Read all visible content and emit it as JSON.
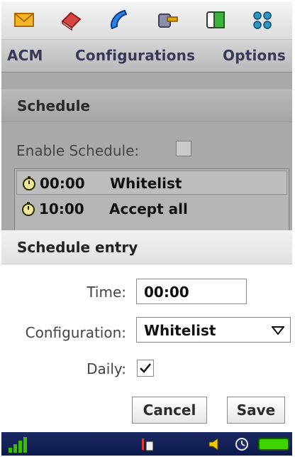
{
  "toolbar_icons": [
    {
      "name": "envelope-icon",
      "color": "#d28a00"
    },
    {
      "name": "book-icon",
      "color": "#c43a3a"
    },
    {
      "name": "phone-icon",
      "color": "#1d6fd1"
    },
    {
      "name": "camera-icon",
      "color": "#6d6f8a"
    },
    {
      "name": "contacts-icon",
      "color": "#2c9c2c"
    },
    {
      "name": "apps-grid-icon",
      "color": "#1e7fa8"
    }
  ],
  "menu": {
    "acm": "ACM",
    "configurations": "Configurations",
    "options": "Options"
  },
  "schedule": {
    "title": "Schedule",
    "enable_label": "Enable Schedule:",
    "enable_checked": false,
    "entries": [
      {
        "time": "00:00",
        "config": "Whitelist",
        "selected": true
      },
      {
        "time": "10:00",
        "config": "Accept all",
        "selected": false
      }
    ]
  },
  "entry": {
    "title": "Schedule entry",
    "time_label": "Time:",
    "time_value": "00:00",
    "config_label": "Configuration:",
    "config_value": "Whitelist",
    "daily_label": "Daily:",
    "daily_checked": true,
    "cancel_label": "Cancel",
    "save_label": "Save"
  },
  "status_icons": [
    "signal-icon",
    "network-icon",
    "volume-icon",
    "clock-icon",
    "battery-icon"
  ],
  "colors": {
    "menu_text": "#363a58",
    "status_bg": "#14225a",
    "signal_green": "#36c000",
    "battery_green": "#3fd400"
  }
}
